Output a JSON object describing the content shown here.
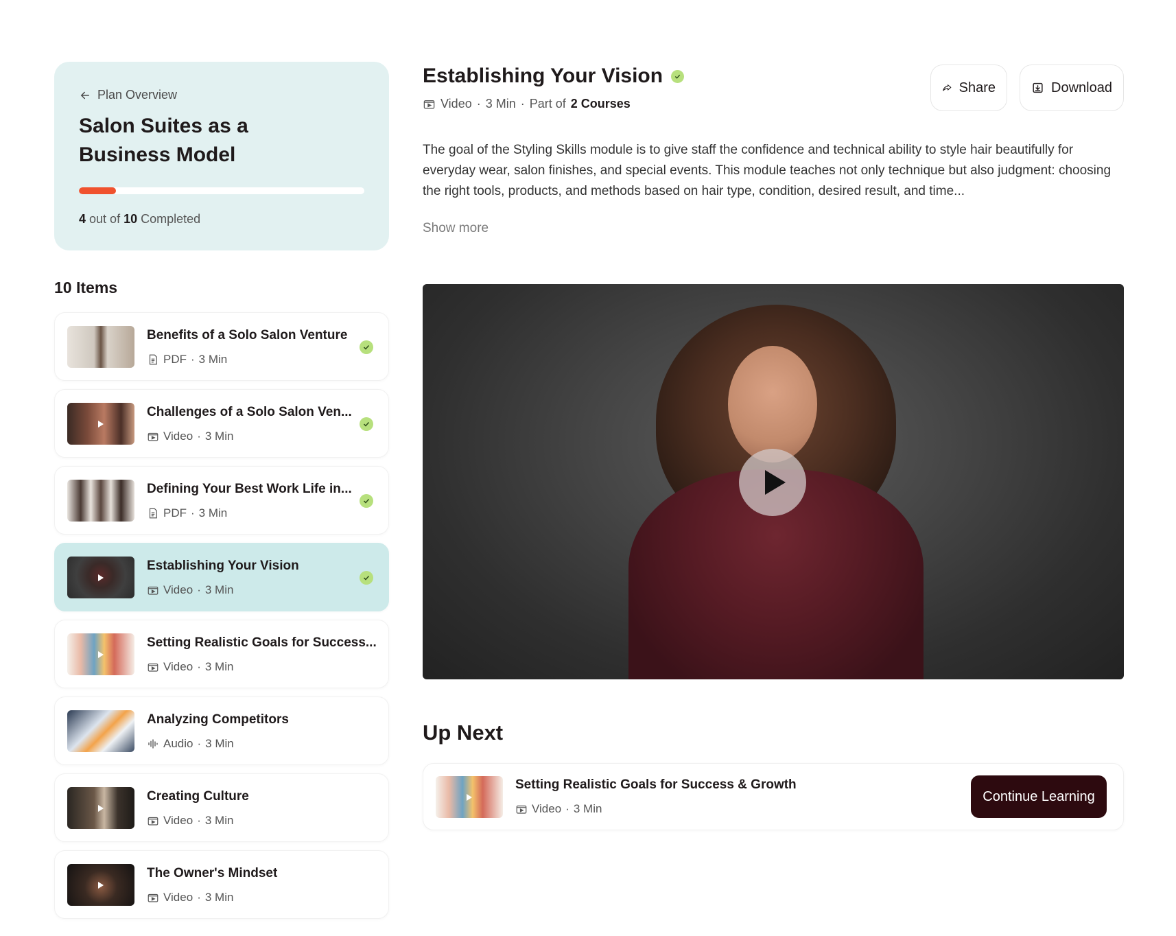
{
  "plan": {
    "back_label": "Plan Overview",
    "title": "Salon Suites as a Business Model",
    "progress": {
      "completed": "4",
      "out_of_text": "out of",
      "total": "10",
      "suffix": "Completed",
      "fraction": 0.13
    }
  },
  "items_heading": "10 Items",
  "items": [
    {
      "title": "Benefits of a Solo Salon Venture",
      "type": "PDF",
      "duration": "3 Min",
      "icon": "pdf-icon",
      "completed": true,
      "active": false
    },
    {
      "title": "Challenges of a Solo Salon Ven...",
      "type": "Video",
      "duration": "3 Min",
      "icon": "video-icon",
      "completed": true,
      "active": false
    },
    {
      "title": "Defining Your Best Work Life in...",
      "type": "PDF",
      "duration": "3 Min",
      "icon": "pdf-icon",
      "completed": true,
      "active": false
    },
    {
      "title": "Establishing Your Vision",
      "type": "Video",
      "duration": "3 Min",
      "icon": "video-icon",
      "completed": true,
      "active": true
    },
    {
      "title": "Setting Realistic Goals for Success...",
      "type": "Video",
      "duration": "3 Min",
      "icon": "video-icon",
      "completed": false,
      "active": false
    },
    {
      "title": "Analyzing Competitors",
      "type": "Audio",
      "duration": "3 Min",
      "icon": "audio-icon",
      "completed": false,
      "active": false
    },
    {
      "title": "Creating Culture",
      "type": "Video",
      "duration": "3 Min",
      "icon": "video-icon",
      "completed": false,
      "active": false
    },
    {
      "title": "The Owner's Mindset",
      "type": "Video",
      "duration": "3 Min",
      "icon": "video-icon",
      "completed": false,
      "active": false
    }
  ],
  "main": {
    "title": "Establishing Your Vision",
    "meta": {
      "type": "Video",
      "duration": "3 Min",
      "part_of": "Part of",
      "courses": "2 Courses"
    },
    "share_label": "Share",
    "download_label": "Download",
    "description": "The goal of the Styling Skills module is to give staff the confidence and technical ability to style hair beautifully for everyday wear, salon finishes, and special events. This module teaches not only technique but also judgment: choosing the right tools, products, and methods based on hair type, condition, desired result, and time...",
    "show_more": "Show more"
  },
  "up_next": {
    "heading": "Up Next",
    "title": "Setting Realistic Goals for Success & Growth",
    "type": "Video",
    "duration": "3 Min",
    "button_label": "Continue Learning"
  },
  "colors": {
    "plan_card_bg": "#e2f1f1",
    "active_item_bg": "#cdeaea",
    "progress_fill": "#f0522e",
    "check_green": "#b7e07d",
    "continue_button": "#2d0a0f"
  }
}
